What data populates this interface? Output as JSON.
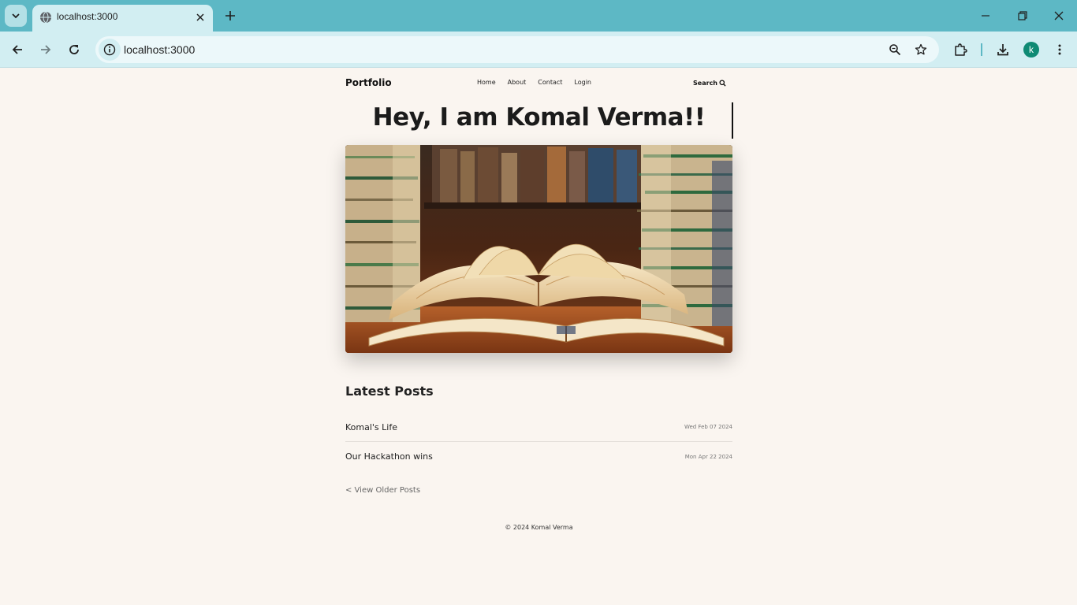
{
  "browser": {
    "tab_title": "localhost:3000",
    "url": "localhost:3000",
    "profile_initial": "k",
    "accent_color": "#5db8c5"
  },
  "site": {
    "logo": "Portfolio",
    "nav": [
      "Home",
      "About",
      "Contact",
      "Login"
    ],
    "search_label": "Search",
    "hero_title": "Hey, I am Komal Verma!!",
    "hero_image_subject": "open books on a table with stacked books",
    "latest_posts_heading": "Latest Posts",
    "posts": [
      {
        "title": "Komal's Life",
        "date": "Wed Feb 07 2024"
      },
      {
        "title": "Our Hackathon wins",
        "date": "Mon Apr 22 2024"
      }
    ],
    "older_posts_link": "< View Older Posts",
    "footer": "© 2024 Komal Verma"
  }
}
